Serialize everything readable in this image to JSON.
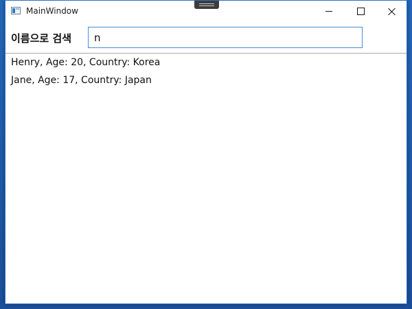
{
  "window": {
    "title": "MainWindow"
  },
  "search": {
    "label": "이름으로 검색",
    "value": "n"
  },
  "results": {
    "items": [
      "Henry, Age: 20, Country: Korea",
      "Jane, Age: 17, Country: Japan"
    ]
  },
  "icons": {
    "app": "app-window-icon",
    "minimize": "minimize-icon",
    "maximize": "maximize-icon",
    "close": "close-icon"
  },
  "colors": {
    "accent": "#4a8ad6",
    "window_border": "#2b6fc4",
    "desktop": "#1e5aa8"
  }
}
